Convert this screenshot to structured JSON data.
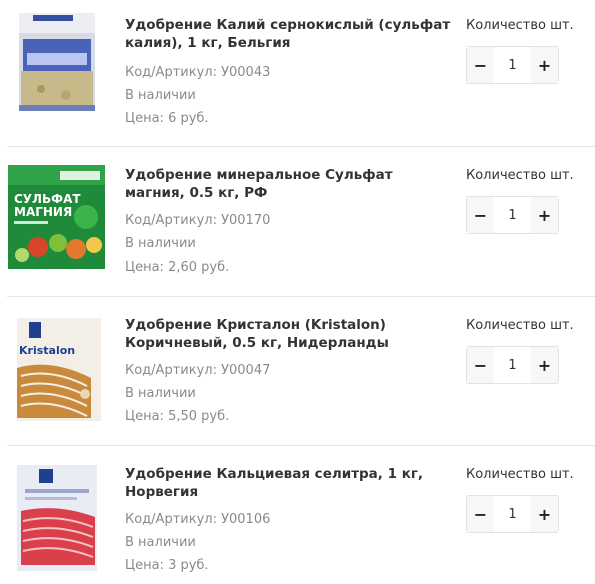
{
  "products": [
    {
      "title": "Удобрение Калий сернокислый (сульфат калия), 1 кг, Бельгия",
      "sku": "Код/Артикул: У00043",
      "stock": "В наличии",
      "price": "Цена: 6 руб.",
      "qty_label": "Количество шт.",
      "qty": "1",
      "image": "potassium-sulfate-bag-image"
    },
    {
      "title": "Удобрение минеральное Сульфат магния, 0.5 кг, РФ",
      "sku": "Код/Артикул: У00170",
      "stock": "В наличии",
      "price": "Цена: 2,60 руб.",
      "qty_label": "Количество шт.",
      "qty": "1",
      "image": "magnesium-sulfate-pack-image",
      "image_text": [
        "СУЛЬФАТ",
        "МАГНИЯ"
      ]
    },
    {
      "title": "Удобрение Кристалон (Kristalon) Коричневый, 0.5 кг, Нидерланды",
      "sku": "Код/Артикул: У00047",
      "stock": "В наличии",
      "price": "Цена: 5,50 руб.",
      "qty_label": "Количество шт.",
      "qty": "1",
      "image": "kristalon-pack-image",
      "image_text": [
        "Kristalon"
      ]
    },
    {
      "title": "Удобрение Кальциевая селитра, 1 кг, Норвегия",
      "sku": "Код/Артикул: У00106",
      "stock": "В наличии",
      "price": "Цена: 3 руб.",
      "qty_label": "Количество шт.",
      "qty": "1",
      "image": "calcium-nitrate-bag-image"
    }
  ],
  "stepper": {
    "minus": "−",
    "plus": "+"
  },
  "colors": {
    "text": "#333333",
    "muted": "#8a8a8a",
    "divider": "#e5e5e5",
    "button_bg": "#f7f7f9"
  }
}
